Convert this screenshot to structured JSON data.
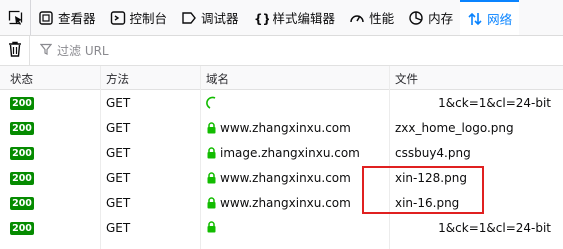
{
  "toolbar": {
    "tabs": [
      {
        "label": "查看器",
        "icon": "inspector-icon"
      },
      {
        "label": "控制台",
        "icon": "console-icon"
      },
      {
        "label": "调试器",
        "icon": "debugger-icon"
      },
      {
        "label": "样式编辑器",
        "icon": "style-editor-icon"
      },
      {
        "label": "性能",
        "icon": "performance-icon"
      },
      {
        "label": "内存",
        "icon": "memory-icon"
      },
      {
        "label": "网络",
        "icon": "network-icon",
        "active": true
      }
    ]
  },
  "filter": {
    "placeholder": "过滤 URL"
  },
  "columns": {
    "status": "状态",
    "method": "方法",
    "domain": "域名",
    "file": "文件"
  },
  "rows": [
    {
      "status": "200",
      "method": "GET",
      "domain": "",
      "file": "1&ck=1&cl=24-bit",
      "loading": true
    },
    {
      "status": "200",
      "method": "GET",
      "domain": "www.zhangxinxu.com",
      "file": "zxx_home_logo.png"
    },
    {
      "status": "200",
      "method": "GET",
      "domain": "image.zhangxinxu.com",
      "file": "cssbuy4.png"
    },
    {
      "status": "200",
      "method": "GET",
      "domain": "www.zhangxinxu.com",
      "file": "xin-128.png"
    },
    {
      "status": "200",
      "method": "GET",
      "domain": "www.zhangxinxu.com",
      "file": "xin-16.png"
    },
    {
      "status": "200",
      "method": "GET",
      "domain": "",
      "file": "1&ck=1&cl=24-bit"
    }
  ],
  "colors": {
    "accent": "#0a84ff",
    "status_ok": "#058b00",
    "secure": "#12bc00",
    "highlight": "#e02020"
  }
}
